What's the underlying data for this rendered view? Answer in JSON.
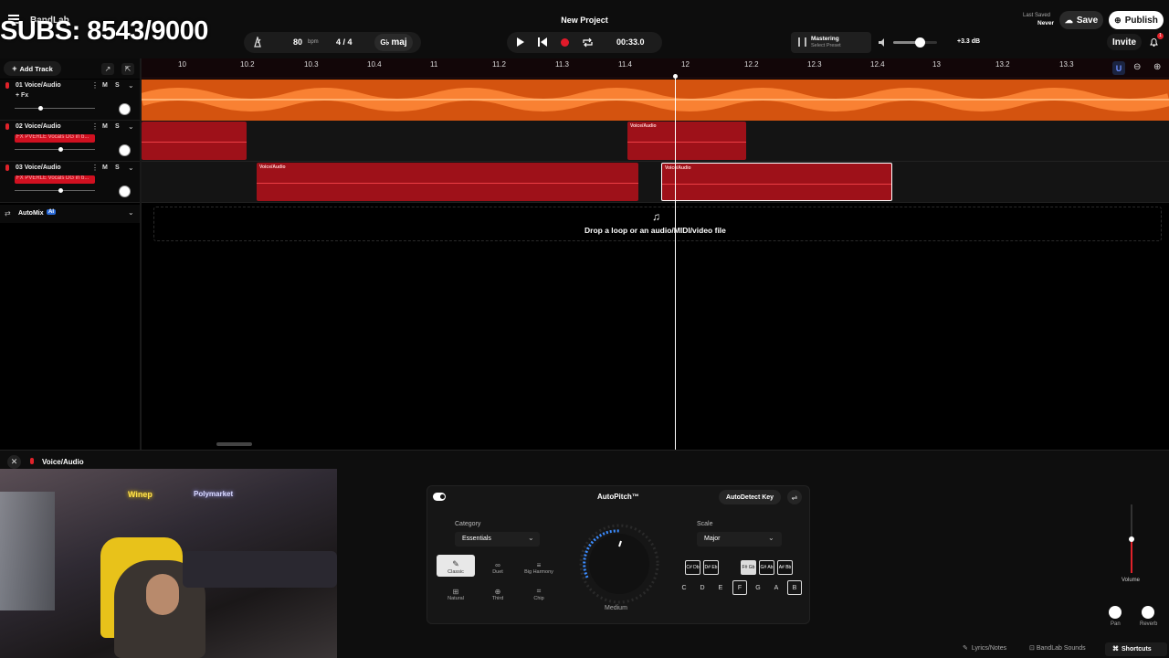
{
  "overlay": {
    "subs": "SUBS: 8543/9000"
  },
  "header": {
    "logo": "BandLab",
    "project_title": "New Project",
    "bpm": "80",
    "bpm_unit": "bpm",
    "time_sig": "4 / 4",
    "key": "maj",
    "time": "00:33.0",
    "mastering_title": "Mastering",
    "mastering_sub": "Select Preset",
    "volume_db": "+3.3 dB",
    "volume_level": 0.6,
    "last_saved_label": "Last Saved",
    "last_saved_value": "Never",
    "save": "Save",
    "publish": "Publish",
    "invite": "Invite",
    "notif_count": "1"
  },
  "toolbar": {
    "add_track": "Add Track"
  },
  "ruler": {
    "ticks": [
      "10",
      "10.2",
      "10.3",
      "10.4",
      "11",
      "11.2",
      "11.3",
      "11.4",
      "12",
      "12.2",
      "12.3",
      "12.4",
      "13",
      "13.2",
      "13.3"
    ]
  },
  "tracks": [
    {
      "name": "01 Voice/Audio",
      "fx": "+ Fx",
      "m": "M",
      "s": "S"
    },
    {
      "name": "02 Voice/Audio",
      "tag": "FX PVERLE Vocals DG in b...",
      "m": "M",
      "s": "S"
    },
    {
      "name": "03 Voice/Audio",
      "tag": "FX PVERLE Vocals DG in b...",
      "m": "M",
      "s": "S"
    }
  ],
  "automix": {
    "label": "AutoMix",
    "badge": "AI"
  },
  "clips": {
    "label": "Voice/Audio"
  },
  "drop_zone": {
    "text": "Drop a loop or an audio/MIDI/video file"
  },
  "bottom_panel": {
    "track_name": "Voice/Audio"
  },
  "autopitch": {
    "title": "AutoPitch™",
    "autodetect": "AutoDetect Key",
    "category_label": "Category",
    "category_value": "Essentials",
    "styles": [
      "Classic",
      "Duet",
      "Big Harmony",
      "Natural",
      "Third",
      "Chip"
    ],
    "knob_label": "Medium",
    "scale_label": "Scale",
    "scale_value": "Major",
    "sharps": [
      "C# Db",
      "D# Eb",
      "F# Gb",
      "G# Ab",
      "A# Bb"
    ],
    "notes": [
      "C",
      "D",
      "E",
      "F",
      "G",
      "A",
      "B"
    ]
  },
  "mixer": {
    "volume": "Volume",
    "pan": "Pan",
    "reverb": "Reverb"
  },
  "footer": {
    "lyrics": "Lyrics/Notes",
    "sounds": "BandLab Sounds",
    "shortcuts": "Shortcuts"
  },
  "webcam": {
    "sign1": "Winep",
    "sign2": "Polymarket"
  }
}
